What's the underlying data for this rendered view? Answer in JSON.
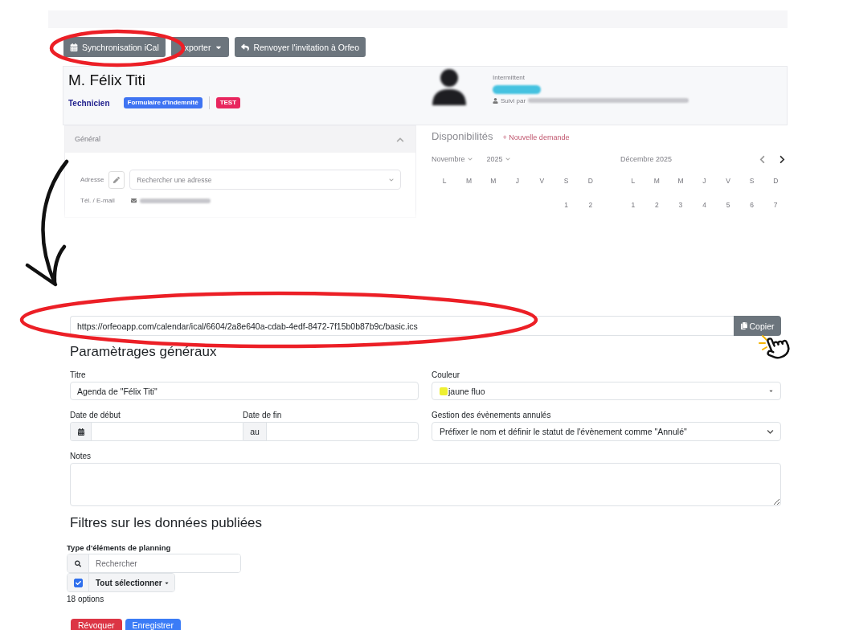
{
  "preview": {
    "toolbar": [
      {
        "kind": "calendar",
        "label": "Synchronisation iCal"
      },
      {
        "kind": "dropdown",
        "label": "xporter"
      },
      {
        "kind": "reply",
        "label": "Renvoyer l'invitation à Orfeo"
      }
    ],
    "profile": {
      "name": "M. Félix Titi",
      "role": "Technicien",
      "badges": [
        {
          "label": "Formulaire d'indemnité",
          "color": "#3f74f2"
        },
        {
          "label": "TEST",
          "color": "#e8265e"
        }
      ],
      "status": "Intermittent",
      "followers_label": "Suivi par"
    },
    "general_panel": {
      "title": "Général",
      "expanded": true,
      "address_label": "Adresse",
      "address_placeholder": "Rechercher une adresse",
      "contact_label": "Tél. / E-mail"
    },
    "availability": {
      "title": "Disponibilités",
      "action": "+ Nouvelle demande",
      "calendars": [
        {
          "kind": "select",
          "month": "Novembre",
          "year": "2025",
          "weekdays": [
            "L",
            "M",
            "M",
            "J",
            "V",
            "S",
            "D"
          ],
          "first_week": [
            "1",
            "2"
          ]
        },
        {
          "kind": "plain",
          "month": "Décembre",
          "year": "2025",
          "weekdays": [
            "L",
            "M",
            "M",
            "J",
            "V",
            "S",
            "D"
          ],
          "first_week": [
            "1",
            "2",
            "3",
            "4",
            "5",
            "6",
            "7"
          ]
        }
      ]
    }
  },
  "ical_link": {
    "url": "https://orfeoapp.com/calendar/ical/6604/2a8e640a-cdab-4edf-8472-7f15b0b87b9c/basic.ics",
    "copy_label": "Copier"
  },
  "general_settings": {
    "title": "Paramètrages généraux",
    "title_field": {
      "label": "Titre",
      "value": "Agenda de \"Félix Titi\""
    },
    "color_field": {
      "label": "Couleur",
      "value": "jaune fluo",
      "color": "#eef032"
    },
    "start_date": {
      "label": "Date de début"
    },
    "end_date": {
      "label": "Date de fin",
      "prefix": "au"
    },
    "cancelled_events": {
      "label": "Gestion des évènements annulés",
      "value": "Préfixer le nom et définir le statut de l'évènement comme \"Annulé\""
    },
    "notes": {
      "label": "Notes"
    }
  },
  "filters": {
    "title": "Filtres sur les données publiées",
    "type_label": "Type d'éléments de planning",
    "search": {
      "placeholder": "Rechercher"
    },
    "select_all": {
      "label": "Tout sélectionner",
      "checked": true
    },
    "count": "18 options"
  },
  "actions": [
    {
      "kind": "danger",
      "label": "Révoquer"
    },
    {
      "kind": "primary",
      "label": "Enregistrer"
    }
  ]
}
